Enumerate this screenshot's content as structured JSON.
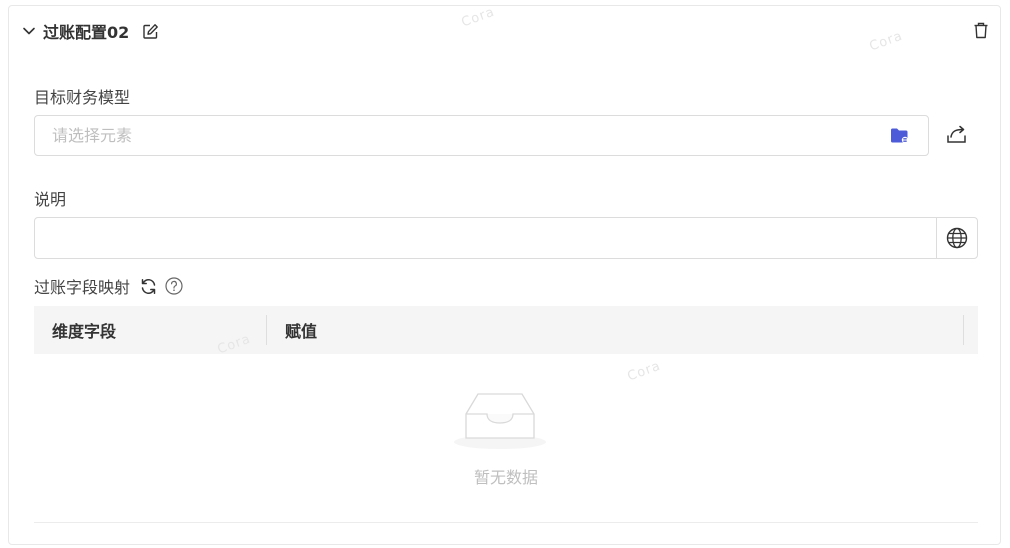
{
  "header": {
    "title": "过账配置02"
  },
  "form": {
    "model_label": "目标财务模型",
    "model_placeholder": "请选择元素",
    "model_value": "",
    "desc_label": "说明",
    "desc_value": ""
  },
  "mapping": {
    "label": "过账字段映射",
    "columns": [
      "维度字段",
      "赋值"
    ],
    "rows": [],
    "empty_text": "暂无数据"
  },
  "watermark": "Cora",
  "colors": {
    "accent": "#4e5bd9",
    "border": "#dcdcdc",
    "table_header_bg": "#f5f5f5",
    "placeholder": "#bfbfbf"
  }
}
